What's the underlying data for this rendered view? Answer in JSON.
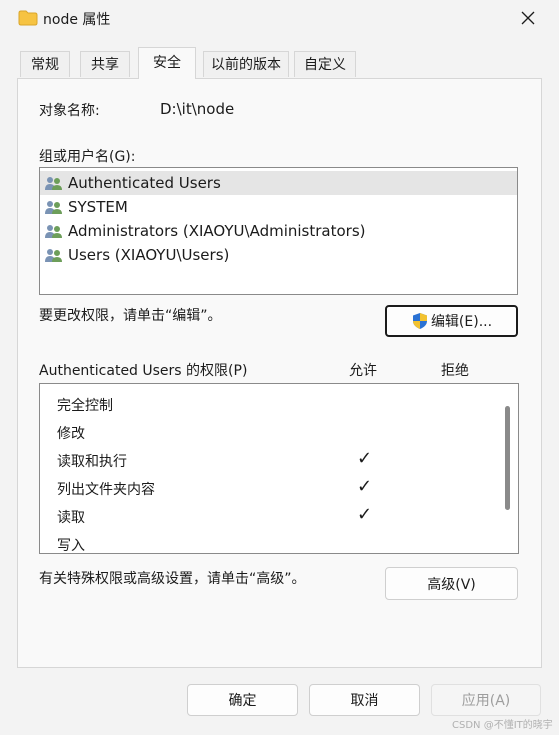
{
  "window": {
    "title": "node 属性"
  },
  "tabs": [
    {
      "label": "常规"
    },
    {
      "label": "共享"
    },
    {
      "label": "安全"
    },
    {
      "label": "以前的版本"
    },
    {
      "label": "自定义"
    }
  ],
  "object": {
    "label": "对象名称:",
    "value": "D:\\it\\node"
  },
  "users": {
    "label": "组或用户名(G):",
    "items": [
      {
        "name": "Authenticated Users",
        "selected": true
      },
      {
        "name": "SYSTEM",
        "selected": false
      },
      {
        "name": "Administrators (XIAOYU\\Administrators)",
        "selected": false
      },
      {
        "name": "Users (XIAOYU\\Users)",
        "selected": false
      }
    ]
  },
  "edit": {
    "hint": "要更改权限，请单击“编辑”。",
    "button_label": "编辑(E)..."
  },
  "permissions": {
    "label": "Authenticated Users 的权限(P)",
    "allow_header": "允许",
    "deny_header": "拒绝",
    "items": [
      {
        "name": "完全控制",
        "allow": false
      },
      {
        "name": "修改",
        "allow": false
      },
      {
        "name": "读取和执行",
        "allow": true
      },
      {
        "name": "列出文件夹内容",
        "allow": true
      },
      {
        "name": "读取",
        "allow": true
      },
      {
        "name": "写入",
        "allow": false
      }
    ],
    "check_glyph": "✓"
  },
  "advanced": {
    "hint": "有关特殊权限或高级设置，请单击“高级”。",
    "button_label": "高级(V)"
  },
  "footer": {
    "ok": "确定",
    "cancel": "取消",
    "apply": "应用(A)"
  },
  "watermark": "CSDN @不懂IT的晓宇",
  "colors": {
    "folder": "#f6c342",
    "selected_row": "#e5e5e5",
    "border": "#8a8a8a",
    "shield_blue": "#2a72d4",
    "shield_yellow": "#f2c230"
  }
}
